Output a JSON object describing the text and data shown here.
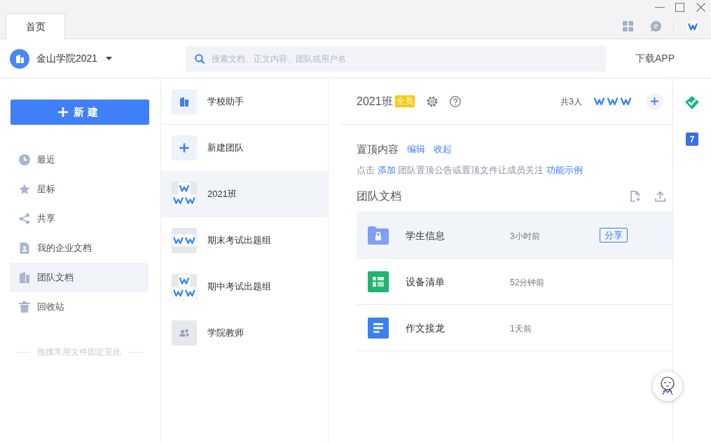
{
  "window": {
    "tabs": [
      {
        "label": "首页",
        "selected": true
      }
    ]
  },
  "header": {
    "account": "金山学院2021",
    "search": {
      "placeholder": "搜索文档、正文内容、团队或用户名"
    },
    "download_link": "下载APP"
  },
  "sidebar": {
    "new_button": "新建",
    "items": [
      {
        "label": "最近",
        "selected": false
      },
      {
        "label": "星标",
        "selected": false
      },
      {
        "label": "共享",
        "selected": false
      },
      {
        "label": "我的企业文档",
        "selected": false
      },
      {
        "label": "团队文档",
        "selected": true
      },
      {
        "label": "回收站",
        "selected": false
      }
    ],
    "drop_hint": "拖拽常用文件固定至此"
  },
  "teams": [
    {
      "name": "学校助手",
      "kind": "assistant",
      "selected": false
    },
    {
      "name": "新建团队",
      "kind": "create",
      "selected": false
    },
    {
      "name": "2021班",
      "kind": "trio",
      "selected": true
    },
    {
      "name": "期末考试出题组",
      "kind": "duo",
      "selected": false
    },
    {
      "name": "期中考试出题组",
      "kind": "trio",
      "selected": false
    },
    {
      "name": "学院教师",
      "kind": "staff",
      "selected": false
    }
  ],
  "team": {
    "title": "2021班",
    "badge": "全员",
    "member_count": "共3人",
    "pinned": {
      "title": "置顶内容",
      "actions": [
        "编辑",
        "收起"
      ],
      "hint": [
        {
          "kind": "text",
          "text": "点击 "
        },
        {
          "kind": "link",
          "text": "添加"
        },
        {
          "kind": "text",
          "text": " 团队置顶公告或置顶文件让成员关注 "
        },
        {
          "kind": "link",
          "text": "功能示例"
        }
      ]
    },
    "docs": {
      "title": "团队文档",
      "rows": [
        {
          "kind": "folder",
          "name": "学生信息",
          "time": "3小时前",
          "action": "分享",
          "selected": true
        },
        {
          "kind": "sheet",
          "name": "设备清单",
          "time": "52分钟前",
          "selected": false
        },
        {
          "kind": "doc",
          "name": "作文接龙",
          "time": "1天前",
          "selected": false
        }
      ]
    }
  },
  "right_rail": {
    "calendar_day": "7"
  }
}
